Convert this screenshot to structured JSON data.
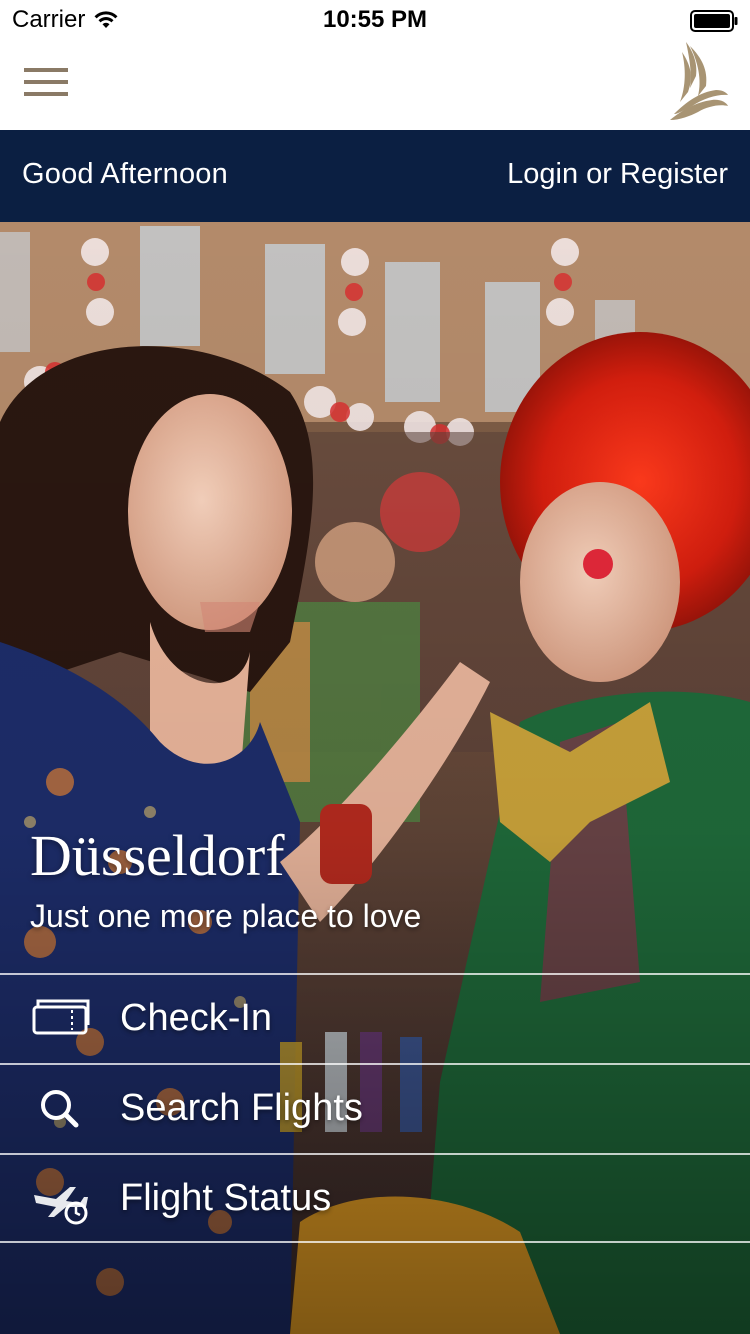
{
  "status_bar": {
    "carrier": "Carrier",
    "time": "10:55 PM",
    "wifi_icon": "wifi-icon",
    "battery_icon": "battery-icon"
  },
  "header": {
    "menu_icon": "hamburger-menu-icon",
    "logo_icon": "airline-bird-logo",
    "logo_color": "#a89473"
  },
  "greeting_bar": {
    "greeting": "Good Afternoon",
    "login_label": "Login or Register",
    "background_color": "#0b1f42"
  },
  "hero": {
    "destination": "Düsseldorf",
    "tagline": "Just one more place to love",
    "actions": [
      {
        "label": "Check-In",
        "icon": "boarding-pass-icon"
      },
      {
        "label": "Search Flights",
        "icon": "search-icon"
      },
      {
        "label": "Flight Status",
        "icon": "plane-clock-icon"
      }
    ]
  }
}
